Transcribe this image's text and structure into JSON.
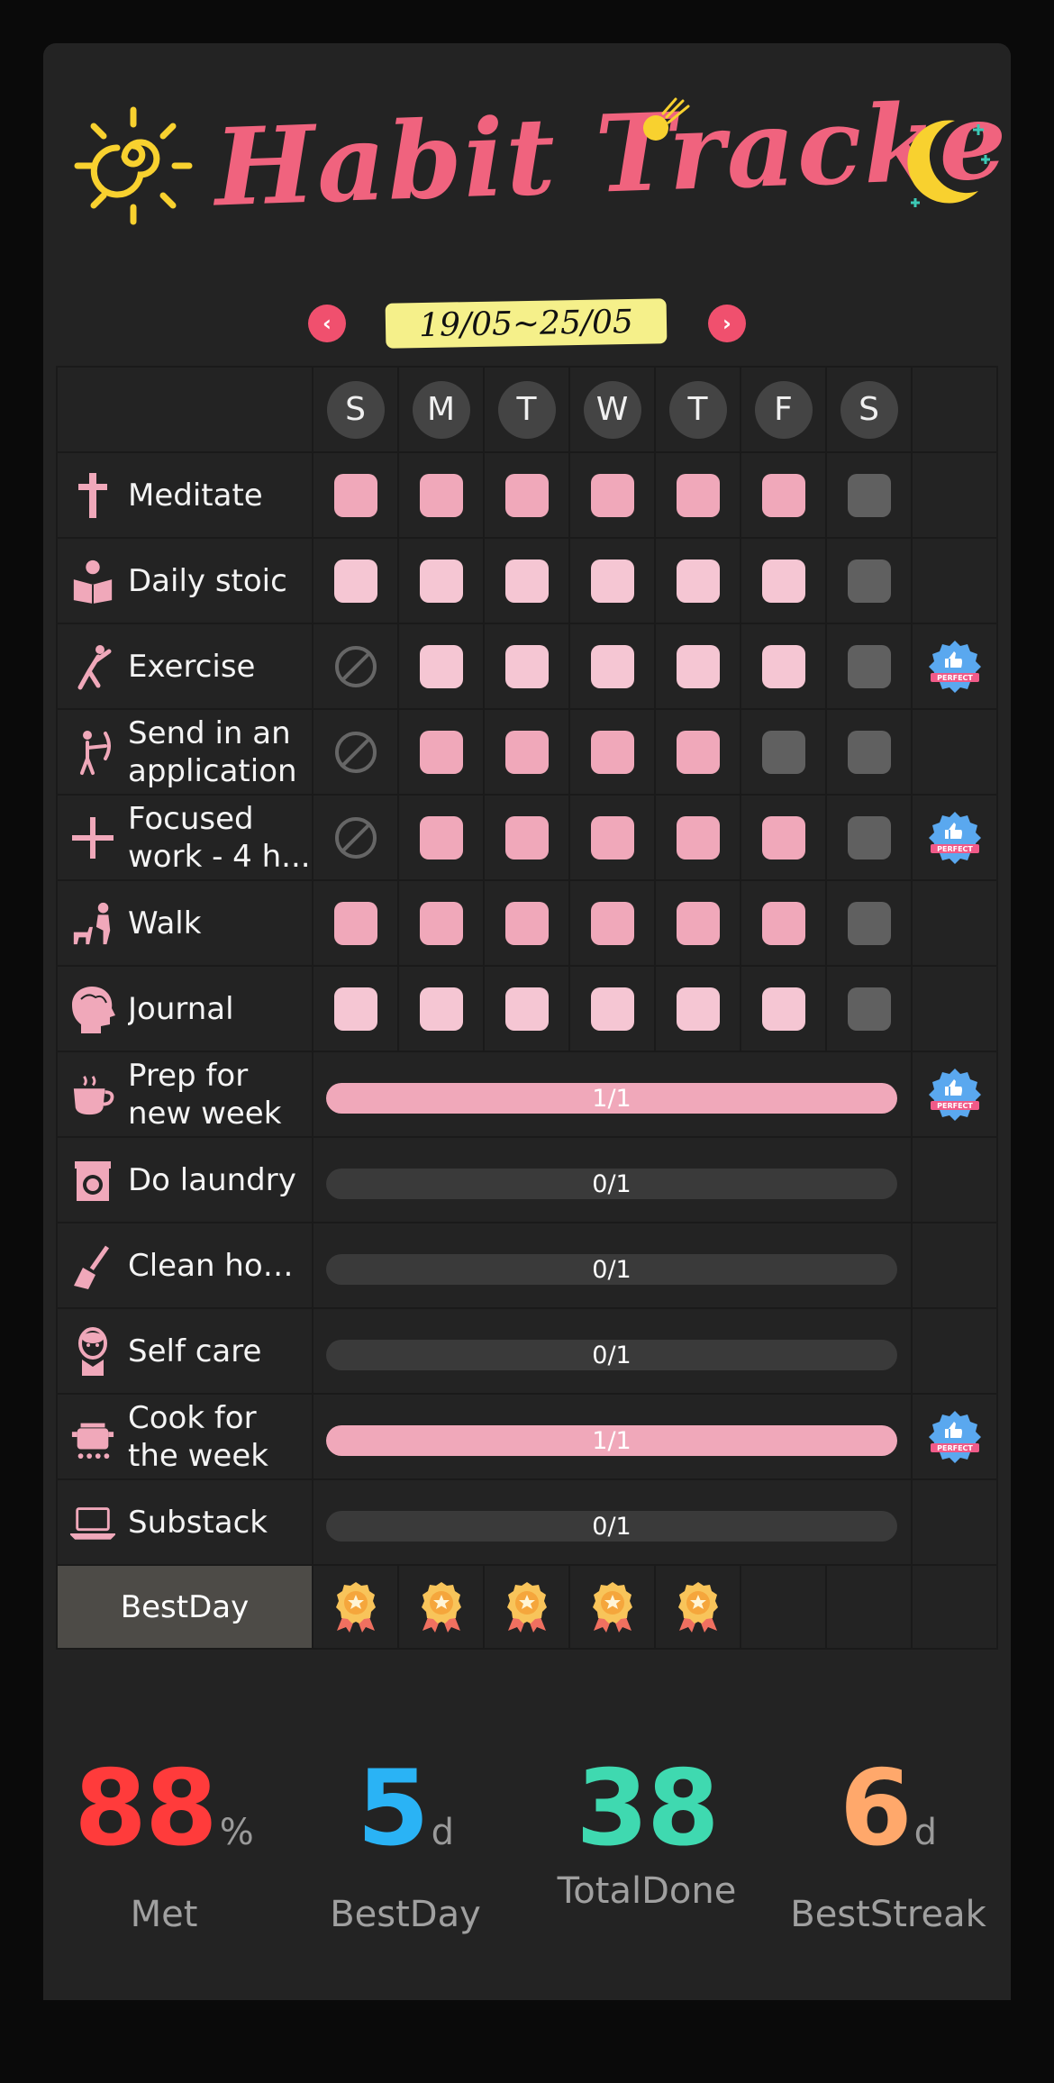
{
  "header": {
    "title": "Habit Tracker",
    "accent": "#f0637e"
  },
  "week": {
    "range": "19/05~25/05",
    "prev_icon": "chevron-left-icon",
    "next_icon": "chevron-right-icon"
  },
  "days": [
    "S",
    "M",
    "T",
    "W",
    "T",
    "F",
    "S"
  ],
  "habits": [
    {
      "label": "Meditate",
      "icon": "cross-icon",
      "type": "daily",
      "days": [
        "done",
        "done",
        "done",
        "done",
        "done",
        "done",
        "empty"
      ],
      "perfect": false
    },
    {
      "label": "Daily stoic",
      "icon": "reader-icon",
      "type": "daily",
      "days": [
        "light",
        "light",
        "light",
        "light",
        "light",
        "light",
        "empty"
      ],
      "perfect": false
    },
    {
      "label": "Exercise",
      "icon": "stretch-icon",
      "type": "daily",
      "days": [
        "skip",
        "light",
        "light",
        "light",
        "light",
        "light",
        "empty"
      ],
      "perfect": true
    },
    {
      "label": "Send in an application",
      "icon": "archer-icon",
      "type": "daily",
      "days": [
        "skip",
        "done",
        "done",
        "done",
        "done",
        "empty",
        "empty"
      ],
      "perfect": false
    },
    {
      "label": "Focused work - 4 h...",
      "icon": "plus-icon",
      "type": "daily",
      "days": [
        "skip",
        "done",
        "done",
        "done",
        "done",
        "done",
        "empty"
      ],
      "perfect": true
    },
    {
      "label": "Walk",
      "icon": "dog-walk-icon",
      "type": "daily",
      "days": [
        "done",
        "done",
        "done",
        "done",
        "done",
        "done",
        "empty"
      ],
      "perfect": false
    },
    {
      "label": "Journal",
      "icon": "brain-head-icon",
      "type": "daily",
      "days": [
        "light",
        "light",
        "light",
        "light",
        "light",
        "light",
        "empty"
      ],
      "perfect": false
    },
    {
      "label": "Prep for new week",
      "icon": "coffee-cup-icon",
      "type": "weekly",
      "progress": "1/1",
      "ratio": 1,
      "perfect": true
    },
    {
      "label": "Do laundry",
      "icon": "laundry-icon",
      "type": "weekly",
      "progress": "0/1",
      "ratio": 0,
      "perfect": false
    },
    {
      "label": "Clean house",
      "icon": "broom-icon",
      "type": "weekly",
      "progress": "0/1",
      "ratio": 0,
      "perfect": false
    },
    {
      "label": "Self care",
      "icon": "face-mask-icon",
      "type": "weekly",
      "progress": "0/1",
      "ratio": 0,
      "perfect": false
    },
    {
      "label": "Cook for the week",
      "icon": "cooking-pot-icon",
      "type": "weekly",
      "progress": "1/1",
      "ratio": 1,
      "perfect": true
    },
    {
      "label": "Substack",
      "icon": "laptop-icon",
      "type": "weekly",
      "progress": "0/1",
      "ratio": 0,
      "perfect": false
    }
  ],
  "bestday": {
    "label": "BestDay",
    "medals": [
      true,
      true,
      true,
      true,
      true,
      false,
      false
    ]
  },
  "perfect_badge_text": "PERFECT",
  "stats": [
    {
      "value": "88",
      "unit": "%",
      "label": "Met",
      "color": "#ff3b3b"
    },
    {
      "value": "5",
      "unit": "d",
      "label": "BestDay",
      "color": "#2ab3f5"
    },
    {
      "value": "38",
      "unit": "",
      "label": "TotalDone",
      "color": "#3fd9b0"
    },
    {
      "value": "6",
      "unit": "d",
      "label": "BestStreak",
      "color": "#ffa86b"
    }
  ]
}
